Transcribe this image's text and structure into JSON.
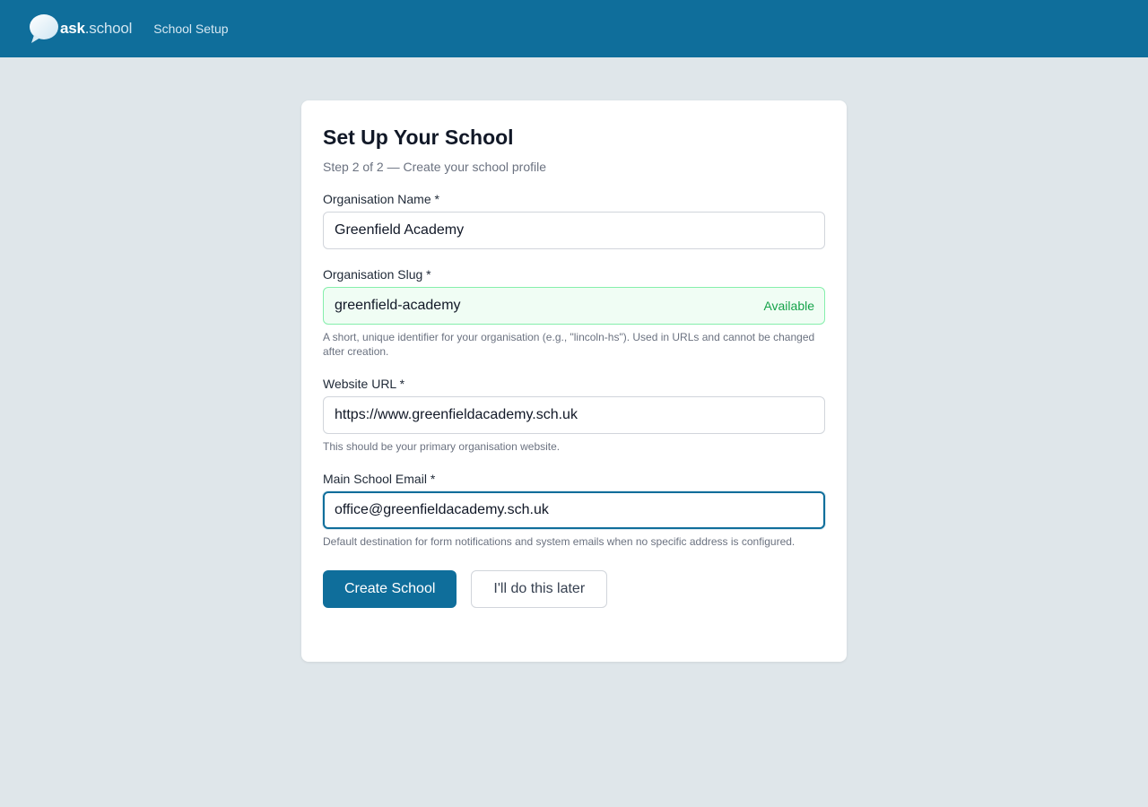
{
  "header": {
    "logo_main": "ask",
    "logo_suffix": ".school",
    "nav_label": "School Setup"
  },
  "form": {
    "title": "Set Up Your School",
    "subtitle": "Step 2 of 2 — Create your school profile",
    "org_name": {
      "label": "Organisation Name *",
      "value": "Greenfield Academy"
    },
    "org_slug": {
      "label": "Organisation Slug *",
      "value": "greenfield-academy",
      "status": "Available",
      "help": "A short, unique identifier for your organisation (e.g., \"lincoln-hs\"). Used in URLs and cannot be changed after creation."
    },
    "website": {
      "label": "Website URL *",
      "value": "https://www.greenfieldacademy.sch.uk",
      "help": "This should be your primary organisation website."
    },
    "email": {
      "label": "Main School Email *",
      "value": "office@greenfieldacademy.sch.uk",
      "help": "Default destination for form notifications and system emails when no specific address is configured."
    },
    "create_label": "Create School",
    "later_label": "I'll do this later"
  },
  "colors": {
    "brand": "#0f6e9b",
    "success": "#16a34a",
    "background": "#dfe6ea"
  },
  "icons": {
    "logo": "speech-bubble-icon"
  }
}
